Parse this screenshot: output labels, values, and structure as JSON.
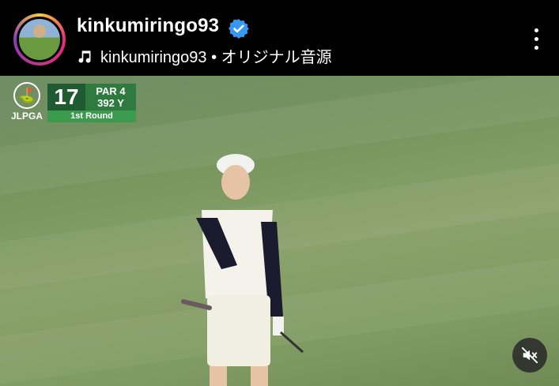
{
  "header": {
    "username": "kinkumiringo93",
    "audio_label": "kinkumiringo93 • オリジナル音源",
    "verified_icon": "verified-badge-icon",
    "menu_icon": "more-vertical-icon"
  },
  "video": {
    "overlay": {
      "org": "JLPGA",
      "hole": "17",
      "par": "PAR 4",
      "yards": "392 Y",
      "round": "1st Round"
    },
    "mute_icon": "muted-speaker-icon"
  },
  "colors": {
    "accent": "#3897f0",
    "score_dark": "#1f5a30",
    "score_mid": "#2f7b3f",
    "score_light": "#3b9a4d"
  }
}
